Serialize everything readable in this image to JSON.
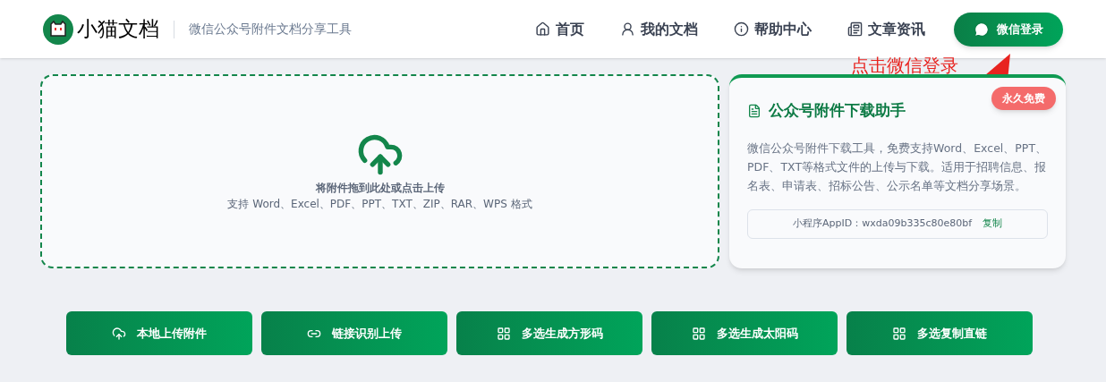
{
  "header": {
    "brand": "小猫文档",
    "tagline": "微信公众号附件文档分享工具",
    "nav": [
      {
        "label": "首页",
        "kind": "home"
      },
      {
        "label": "我的文档",
        "kind": "docs"
      },
      {
        "label": "帮助中心",
        "kind": "help"
      },
      {
        "label": "文章资讯",
        "kind": "news"
      }
    ],
    "login_button": "微信登录"
  },
  "annotation": {
    "text": "点击微信登录"
  },
  "upload": {
    "title": "将附件拖到此处或点击上传",
    "hint": "支持 Word、Excel、PDF、PPT、TXT、ZIP、RAR、WPS 格式"
  },
  "info_card": {
    "title": "公众号附件下载助手",
    "badge": "永久免费",
    "description": "微信公众号附件下载工具，免费支持Word、Excel、PPT、PDF、TXT等格式文件的上传与下载。适用于招聘信息、报名表、申请表、招标公告、公示名单等文档分享场景。",
    "appid": "小程序AppID：wxda09b335c80e80bf",
    "copy": "复制"
  },
  "actions": [
    {
      "label": "本地上传附件",
      "kind": "upload"
    },
    {
      "label": "链接识别上传",
      "kind": "link"
    },
    {
      "label": "多选生成方形码",
      "kind": "grid"
    },
    {
      "label": "多选生成太阳码",
      "kind": "grid"
    },
    {
      "label": "多选复制直链",
      "kind": "grid"
    }
  ]
}
